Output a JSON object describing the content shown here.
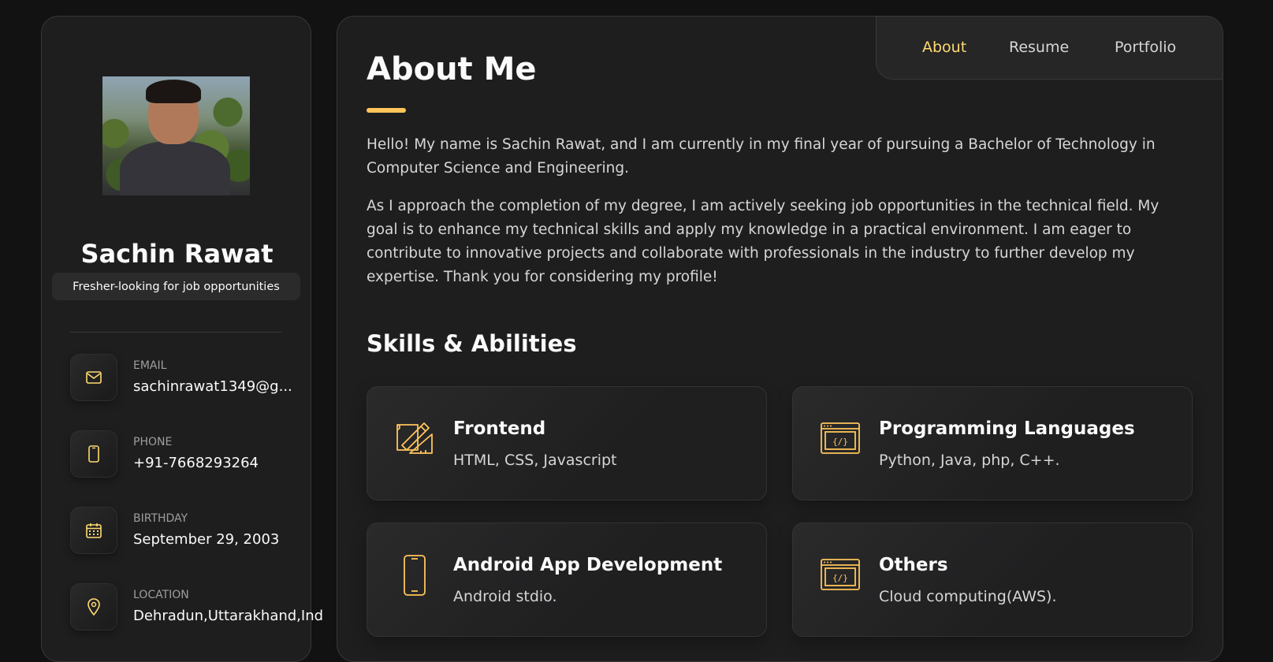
{
  "profile": {
    "name": "Sachin Rawat",
    "title": "Fresher-looking for job opportunities"
  },
  "contacts": [
    {
      "label": "EMAIL",
      "value": "sachinrawat1349@g...",
      "icon": "mail-icon"
    },
    {
      "label": "PHONE",
      "value": "+91-7668293264",
      "icon": "phone-icon"
    },
    {
      "label": "BIRTHDAY",
      "value": "September 29, 2003",
      "icon": "calendar-icon"
    },
    {
      "label": "LOCATION",
      "value": "Dehradun,Uttarakhand,Ind",
      "icon": "location-pin-icon"
    }
  ],
  "nav": {
    "items": [
      {
        "label": "About",
        "active": true
      },
      {
        "label": "Resume",
        "active": false
      },
      {
        "label": "Portfolio",
        "active": false
      }
    ]
  },
  "about": {
    "heading": "About Me",
    "paragraphs": [
      "Hello! My name is Sachin Rawat, and I am currently in my final year of pursuing a Bachelor of Technology in Computer Science and Engineering.",
      "As I approach the completion of my degree, I am actively seeking job opportunities in the technical field. My goal is to enhance my technical skills and apply my knowledge in a practical environment. I am eager to contribute to innovative projects and collaborate with professionals in the industry to further develop my expertise. Thank you for considering my profile!"
    ]
  },
  "skills": {
    "heading": "Skills & Abilities",
    "cards": [
      {
        "title": "Frontend",
        "text": "HTML, CSS, Javascript",
        "icon": "design-tools-icon"
      },
      {
        "title": "Programming Languages",
        "text": "Python, Java, php, C++.",
        "icon": "code-window-icon"
      },
      {
        "title": "Android App Development",
        "text": "Android stdio.",
        "icon": "smartphone-icon"
      },
      {
        "title": "Others",
        "text": "Cloud computing(AWS).",
        "icon": "code-window-icon"
      }
    ]
  },
  "colors": {
    "accent": "#ffdb70",
    "background": "#121212",
    "panel": "#1e1e1f"
  }
}
